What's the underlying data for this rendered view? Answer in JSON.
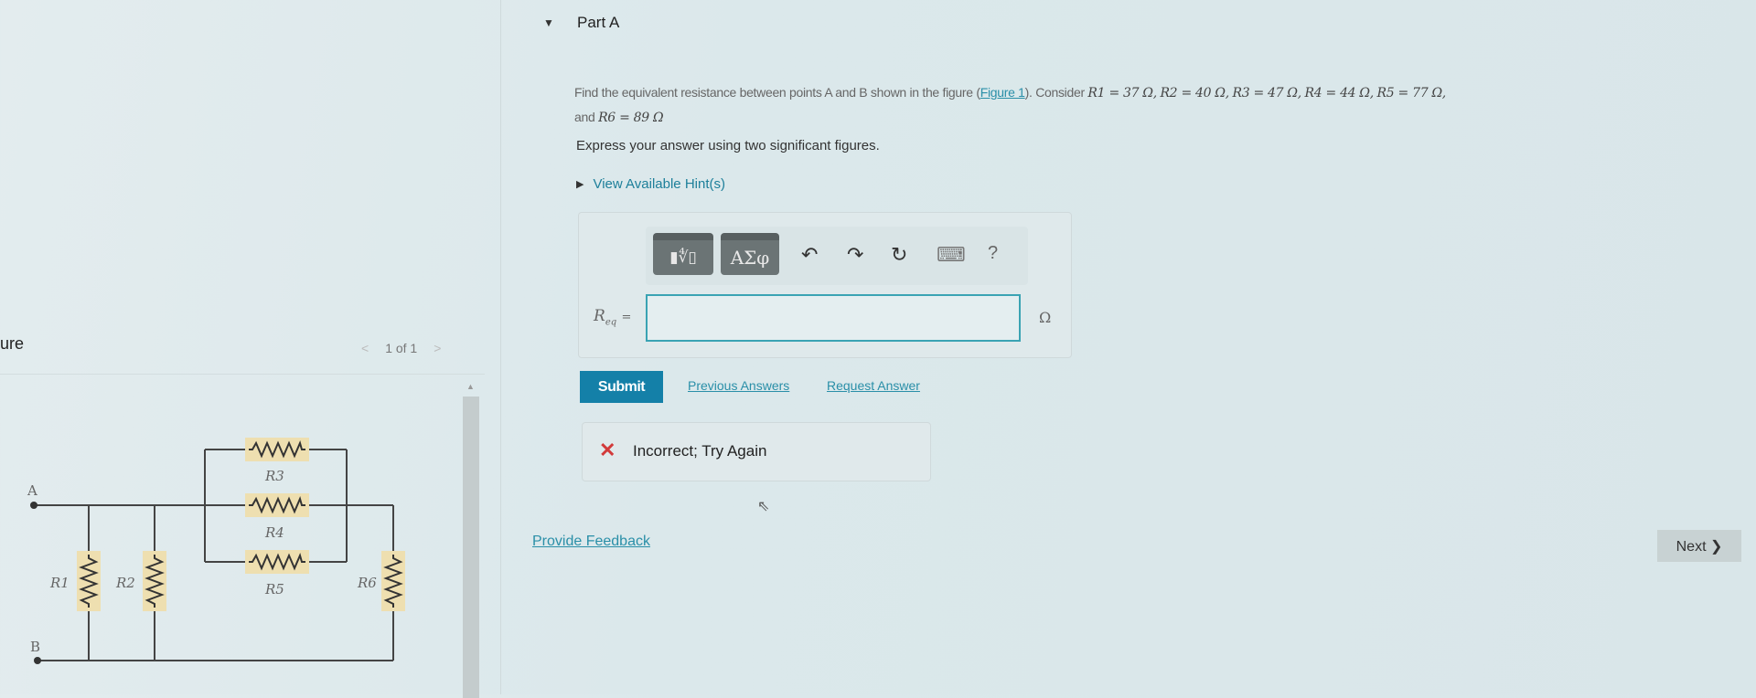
{
  "figure_panel": {
    "title": "ure",
    "pager": {
      "prev": "<",
      "text": "1 of 1",
      "next": ">"
    },
    "circuit": {
      "node_a": "A",
      "node_b": "B",
      "labels": {
        "r1": "R1",
        "r2": "R2",
        "r3": "R3",
        "r4": "R4",
        "r5": "R5",
        "r6": "R6"
      },
      "resistor_color": "#eedfb0"
    }
  },
  "part": {
    "title": "Part A",
    "problem": {
      "text_before": "Find the equivalent resistance between points A and B shown in the figure (",
      "figure_link": "Figure 1",
      "text_after": "). Consider",
      "values": [
        {
          "sym": "R1",
          "val": "= 37 Ω,"
        },
        {
          "sym": "R2",
          "val": "= 40 Ω,"
        },
        {
          "sym": "R3",
          "val": "= 47 Ω,"
        },
        {
          "sym": "R4",
          "val": "= 44 Ω,"
        },
        {
          "sym": "R5",
          "val": "= 77 Ω,"
        }
      ],
      "and": "and",
      "last": {
        "sym": "R6",
        "val": "= 89 Ω"
      }
    },
    "instruction": "Express your answer using two significant figures.",
    "hint_label": "View Available Hint(s)",
    "toolbar": {
      "templates": "▮∜▯",
      "symbols": "ΑΣφ",
      "undo": "↶",
      "redo": "↷",
      "reset": "↻",
      "keyboard": "⌨",
      "help": "?"
    },
    "answer": {
      "label": "R",
      "label_sub": "eq",
      "equals": "=",
      "value": "",
      "unit": "Ω"
    },
    "submit": "Submit",
    "previous_answers": "Previous Answers",
    "request_answer": "Request Answer",
    "feedback": {
      "icon": "✕",
      "text": "Incorrect; Try Again",
      "color": "#d23a3a"
    },
    "provide_feedback": "Provide Feedback",
    "next": "Next ❯"
  }
}
